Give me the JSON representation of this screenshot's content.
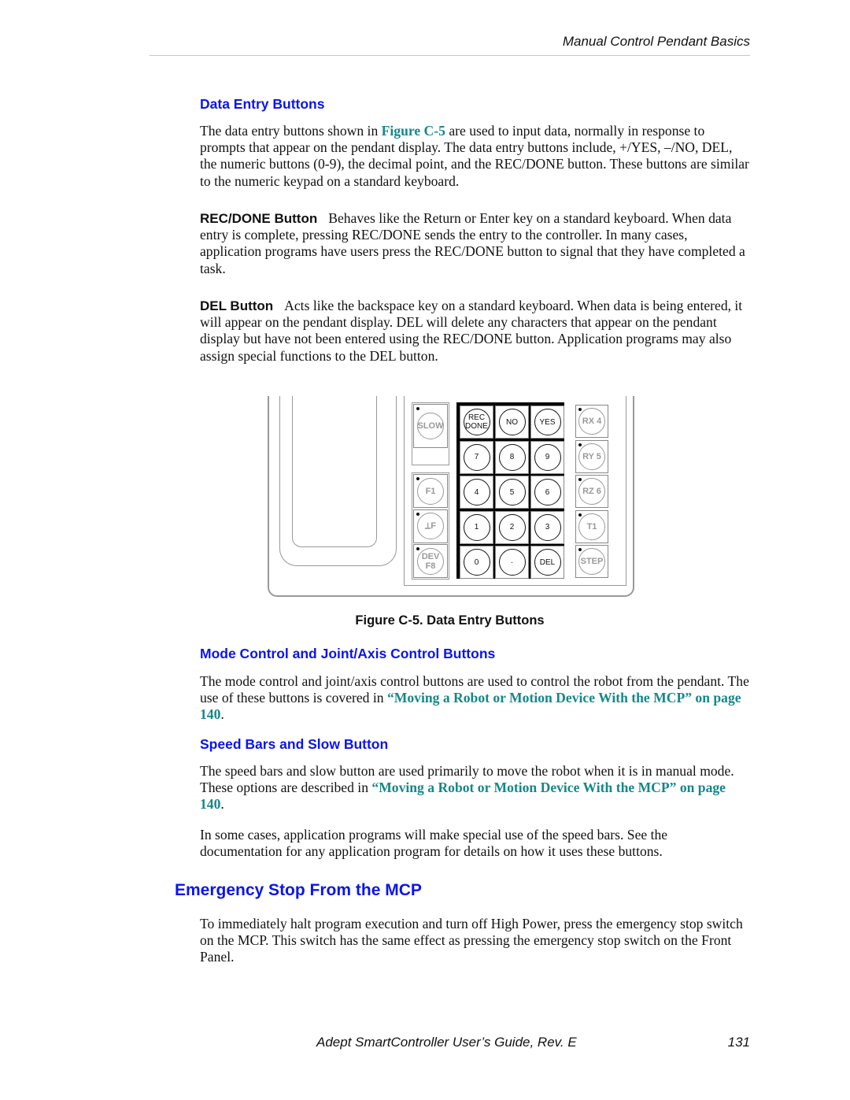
{
  "header": {
    "title": "Manual Control Pendant Basics"
  },
  "sections": {
    "data_entry": {
      "heading": "Data Entry Buttons",
      "p1_a": "The data entry buttons shown in ",
      "p1_link": "Figure C-5",
      "p1_b": " are used to input data, normally in response to prompts that appear on the pendant display. The data entry buttons include, +/YES, –/NO, DEL, the numeric buttons (0-9), the decimal point, and the REC/DONE button. These buttons are similar to the numeric keypad on a standard keyboard.",
      "rec_label": "REC/DONE Button",
      "rec_text": "Behaves like the Return or Enter key on a standard keyboard. When data entry is complete, pressing REC/DONE sends the entry to the controller. In many cases, application programs have users press the REC/DONE button to signal that they have completed a task.",
      "del_label": "DEL Button",
      "del_text": "Acts like the backspace key on a standard keyboard. When data is being entered, it will appear on the pendant display. DEL will delete any characters that appear on the pendant display but have not been entered using the REC/DONE button. Application programs may also assign special functions to the DEL button."
    },
    "figure": {
      "caption": "Figure C-5. Data Entry Buttons",
      "keypad": [
        "REC DONE",
        "NO",
        "YES",
        "7",
        "8",
        "9",
        "4",
        "5",
        "6",
        "1",
        "2",
        "3",
        "0",
        "·",
        "DEL"
      ],
      "left_keys": [
        "SLOW",
        "F1",
        "⟂F",
        "DEV F8"
      ],
      "right_keys": [
        "RX 4",
        "RY 5",
        "RZ 6",
        "T1",
        "STEP"
      ]
    },
    "mode": {
      "heading": "Mode Control and Joint/Axis Control Buttons",
      "text": "The mode control and joint/axis control buttons are used to control the robot from the pendant. The use of these buttons is covered in ",
      "link": "“Moving a Robot or Motion Device With the MCP” on page 140",
      "end": "."
    },
    "speed": {
      "heading": "Speed Bars and Slow Button",
      "text": "The speed bars and slow button are used primarily to move the robot when it is in manual mode. These options are described in ",
      "link": "“Moving a Robot or Motion Device With the MCP” on page 140",
      "end": ".",
      "p2": "In some cases, application programs will make special use of the speed bars. See the documentation for any application program for details on how it uses these buttons."
    },
    "estop": {
      "heading": "Emergency Stop From the MCP",
      "text": "To immediately halt program execution and turn off High Power, press the emergency stop switch on the MCP. This switch has the same effect as pressing the emergency stop switch on the Front Panel."
    }
  },
  "footer": {
    "title": "Adept SmartController User’s Guide, Rev. E",
    "page": "131"
  },
  "colors": {
    "heading": "#0a14f0",
    "link": "#15878a",
    "rule": "#e3c67a"
  }
}
